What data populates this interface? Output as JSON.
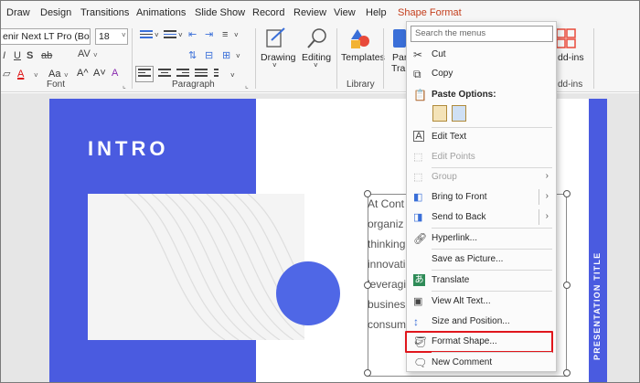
{
  "ribbon": {
    "tabs": [
      "Draw",
      "Design",
      "Transitions",
      "Animations",
      "Slide Show",
      "Record",
      "Review",
      "View",
      "Help",
      "Shape Format"
    ],
    "font_name": "enir Next LT Pro (Body)",
    "font_size": "18",
    "groups": {
      "font": "Font",
      "paragraph": "Paragraph",
      "library": "Library",
      "addins": "dd-ins"
    },
    "buttons": {
      "drawing": "Drawing",
      "editing": "Editing",
      "templates": "Templates",
      "para_trans_1": "Para",
      "para_trans_2": "Tran",
      "addins": "dd-ins"
    },
    "glyphs": {
      "grow_font": "A^",
      "shrink_font": "A˅",
      "font_color": "A",
      "change_case": "Aa",
      "clear_format": "A"
    },
    "accent_color": "#c43e1c"
  },
  "slide": {
    "title": "INTRO",
    "side_text": "PRESENTATION TITLE",
    "body_lines": [
      "At Cont",
      "organiz",
      "thinking",
      "innovati",
      "leveragi",
      "busines",
      "consum"
    ],
    "primary_color": "#4a5be0"
  },
  "context_menu": {
    "search_placeholder": "Search the menus",
    "items": {
      "cut": "Cut",
      "copy": "Copy",
      "paste_options": "Paste Options:",
      "edit_text": "Edit Text",
      "edit_points": "Edit Points",
      "group": "Group",
      "bring_to_front": "Bring to Front",
      "send_to_back": "Send to Back",
      "hyperlink": "Hyperlink...",
      "save_as_picture": "Save as Picture...",
      "translate": "Translate",
      "view_alt_text": "View Alt Text...",
      "size_and_position": "Size and Position...",
      "format_shape": "Format Shape...",
      "new_comment": "New Comment"
    },
    "highlight_color": "#e0161c"
  }
}
